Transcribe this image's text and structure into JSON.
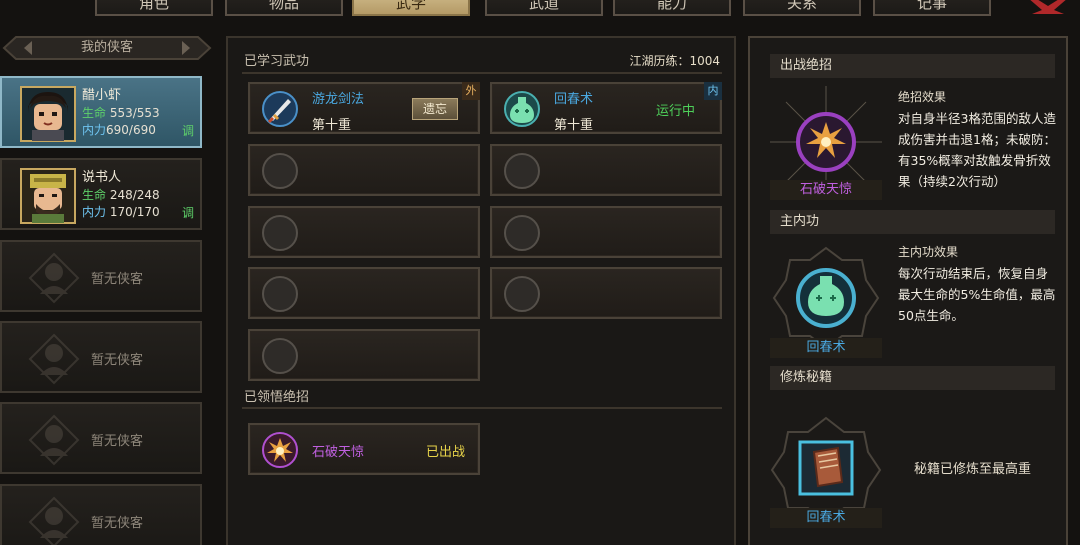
{
  "tabs": [
    "角色",
    "物品",
    "武学",
    "武道",
    "能力",
    "关系",
    "记事"
  ],
  "active_tab_index": 2,
  "sidebar": {
    "header": "我的侠客",
    "characters": [
      {
        "name": "醋小虾",
        "hp_label": "生命",
        "hp_value": "553/553",
        "mp_label": "内力",
        "mp_value": "690/690",
        "action": "调",
        "selected": true
      },
      {
        "name": "说书人",
        "hp_label": "生命",
        "hp_value": "248/248",
        "mp_label": "内力",
        "mp_value": "170/170",
        "action": "调",
        "selected": false
      }
    ],
    "empty_slots": [
      "暂无侠客",
      "暂无侠客",
      "暂无侠客",
      "暂无侠客"
    ]
  },
  "middle": {
    "learned_title": "已学习武功",
    "experience": "江湖历练：1004",
    "skills": [
      {
        "name": "游龙剑法",
        "level": "第十重",
        "button": "遗忘",
        "kind": "外",
        "name_color": "#4aa8e0"
      },
      {
        "name": "回春术",
        "level": "第十重",
        "status": "运行中",
        "kind": "内",
        "name_color": "#4aa8e0"
      }
    ],
    "empty_skill_slots": 7,
    "ultimate_title": "已领悟绝招",
    "ultimates": [
      {
        "name": "石破天惊",
        "status": "已出战",
        "name_color": "#c060e0"
      }
    ]
  },
  "right": {
    "battle_title": "出战绝招",
    "battle_skill_name": "石破天惊",
    "battle_effect_title": "绝招效果",
    "battle_effect_text": "对自身半径3格范围的敌人造成伤害并击退1格；未破防：有35%概率对敌触发骨折效果（持续2次行动）",
    "inner_title": "主内功",
    "inner_skill_name": "回春术",
    "inner_effect_title": "主内功效果",
    "inner_effect_text": "每次行动结束后，恢复自身最大生命的5%生命值，最高50点生命。",
    "manual_title": "修炼秘籍",
    "manual_name": "回春术",
    "manual_note": "秘籍已修炼至最高重"
  },
  "colors": {
    "accent_gold": "#d2bd8c",
    "hp_green": "#5ed06a",
    "mp_blue": "#6ec4f0",
    "skill_blue": "#4aa8e0",
    "ultimate_purple": "#c060e0",
    "status_yellow": "#e8d44a",
    "running_green": "#4ed05a"
  }
}
